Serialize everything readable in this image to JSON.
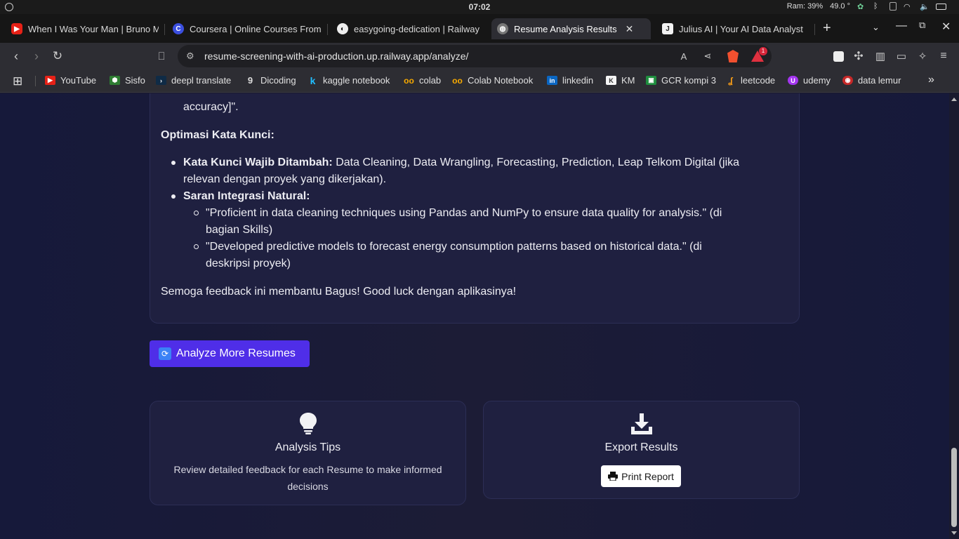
{
  "os": {
    "time": "07:02",
    "ram": "Ram: 39%",
    "temp": "49.0 °"
  },
  "tabs": [
    {
      "title": "When I Was Your Man | Bruno M",
      "icon": "youtube-icon"
    },
    {
      "title": "Coursera | Online Courses From",
      "icon": "coursera-icon"
    },
    {
      "title": "easygoing-dedication | Railway",
      "icon": "railway-icon"
    },
    {
      "title": "Resume Analysis Results",
      "icon": "globe-icon",
      "active": true
    },
    {
      "title": "Julius AI | Your AI Data Analyst",
      "icon": "julius-icon"
    }
  ],
  "address": {
    "url": "resume-screening-with-ai-production.up.railway.app/analyze/",
    "notification_count": "1"
  },
  "bookmarks": [
    "YouTube",
    "Sisfo",
    "deepl translate",
    "Dicoding",
    "kaggle notebook",
    "colab",
    "Colab Notebook",
    "linkedin",
    "KM",
    "GCR kompi 3",
    "leetcode",
    "udemy",
    "data lemur"
  ],
  "feedback": {
    "prev_line": "accuracy]\".",
    "section_title": "Optimasi Kata Kunci:",
    "keywords_label": "Kata Kunci Wajib Ditambah:",
    "keywords_text_1": " Data Cleaning, Data Wrangling, Forecasting, Prediction, Leap Telkom Digital (jika",
    "keywords_text_2": "relevan dengan proyek yang dikerjakan).",
    "integration_label": "Saran Integrasi Natural:",
    "suggestion_1a": "\"Proficient in data cleaning techniques using Pandas and NumPy to ensure data quality for analysis.\" (di",
    "suggestion_1b": "bagian Skills)",
    "suggestion_2a": "\"Developed predictive models to forecast energy consumption patterns based on historical data.\" (di",
    "suggestion_2b": "deskripsi proyek)",
    "closing": "Semoga feedback ini membantu Bagus! Good luck dengan aplikasinya!"
  },
  "actions": {
    "analyze_more": "Analyze More Resumes",
    "tips_title": "Analysis Tips",
    "tips_desc": "Review detailed feedback for each Resume to make informed decisions",
    "export_title": "Export Results",
    "print_label": "Print Report"
  },
  "colors": {
    "primary_button": "#4f2ee8",
    "page_bg": "#1a1b3a",
    "card_bg": "#1f2040"
  }
}
